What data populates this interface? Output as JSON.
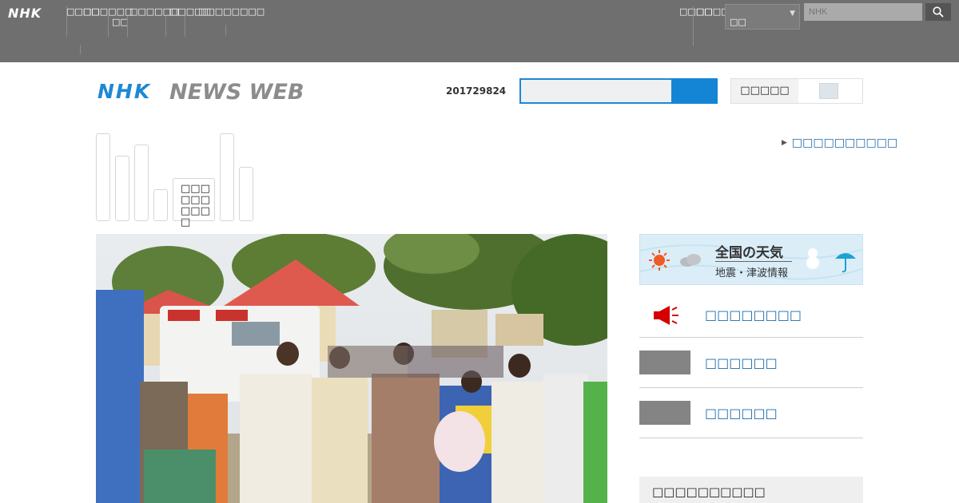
{
  "global_nav": {
    "logo": "NHK",
    "items": [
      "□□□□",
      "□□□□□□",
      "□□",
      "□□□□□□",
      "□□□□□",
      "□□□□□□□□"
    ],
    "right_items": [
      "□□□□",
      "□□□□□"
    ],
    "select_value": "□□",
    "search_placeholder": "NHK"
  },
  "header": {
    "logo_nhk": "NHK",
    "logo_text": "NEWS WEB",
    "counter": "201729824",
    "toggle_label": "□□□□□"
  },
  "category_tabs": {
    "label": "□□□□□□□□□□"
  },
  "more_link": "□□□□□□□□□□",
  "weather": {
    "title": "全国の天気",
    "subtitle": "地震・津波情報"
  },
  "side_links": [
    "□□□□□□□□",
    "□□□□□□",
    "□□□□□□"
  ],
  "side_heading": "□□□□□□□□□□",
  "colors": {
    "topbar": "#6f6f6f",
    "brand_blue": "#1e88d4",
    "link_blue": "#1c6aa8",
    "alert_red": "#d40000"
  },
  "icons": [
    "search-icon",
    "megaphone-icon",
    "sun-icon",
    "cloud-icon",
    "snowman-icon",
    "umbrella-icon"
  ]
}
